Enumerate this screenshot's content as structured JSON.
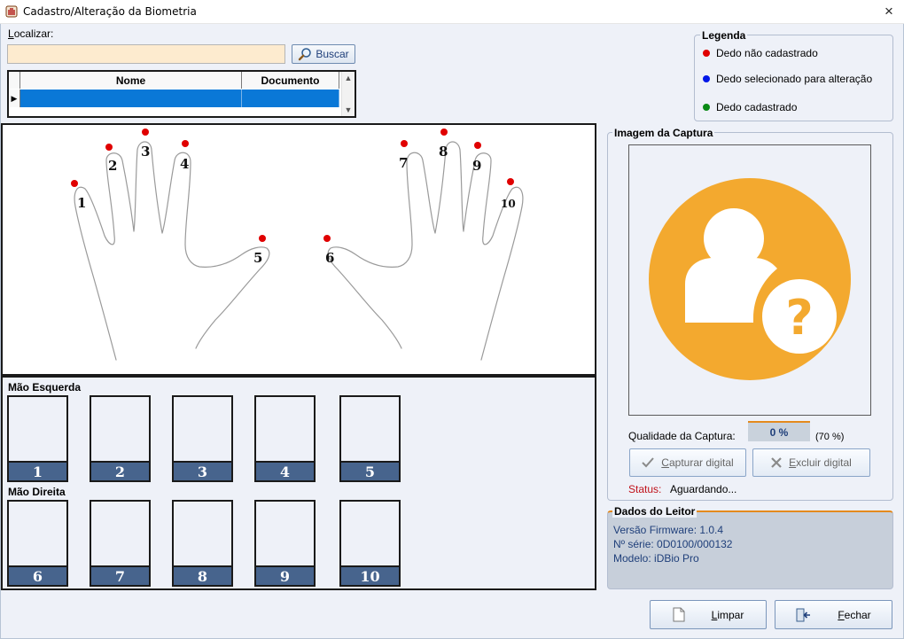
{
  "window": {
    "title": "Cadastro/Alteração da Biometria",
    "icon": "biometric-app-icon",
    "close_icon": "×"
  },
  "search": {
    "label_underlined": "L",
    "label_rest": "ocalizar:",
    "value": "",
    "button_label": "Buscar",
    "button_icon": "magnifier-icon"
  },
  "grid": {
    "columns": [
      "Nome",
      "Documento"
    ],
    "rows": [
      {
        "selected": true,
        "nome": "",
        "documento": ""
      }
    ]
  },
  "legend": {
    "title": "Legenda",
    "items": [
      {
        "label": "Dedo não cadastrado",
        "color": "#e00000"
      },
      {
        "label": "Dedo selecionado para alteração",
        "color": "#0017e8"
      },
      {
        "label": "Dedo cadastrado",
        "color": "#0a8a16"
      }
    ]
  },
  "fingers": {
    "labels": [
      "1",
      "2",
      "3",
      "4",
      "5",
      "6",
      "7",
      "8",
      "9",
      "10"
    ],
    "status_color": "#e00000"
  },
  "slots": {
    "left_hand_label": "Mão Esquerda",
    "right_hand_label": "Mão Direita",
    "left": [
      "1",
      "2",
      "3",
      "4",
      "5"
    ],
    "right": [
      "6",
      "7",
      "8",
      "9",
      "10"
    ]
  },
  "capture": {
    "title": "Imagem da Captura",
    "placeholder_icon": "unknown-user-icon",
    "placeholder_color": "#f3a92f",
    "quality_label": "Qualidade da Captura:",
    "quality_value": "0 %",
    "quality_threshold": "(70 %)",
    "capture_button": "Capturar digital",
    "capture_underlined": "C",
    "capture_rest": "apturar digital",
    "delete_button": "Excluir digital",
    "delete_underlined": "E",
    "delete_rest": "xcluir digital",
    "status_label": "Status:",
    "status_value": "Aguardando..."
  },
  "reader": {
    "title": "Dados do Leitor",
    "firmware": "Versão Firmware: 1.0.4",
    "serial": "Nº série: 0D0100/000132",
    "model": "Modelo: iDBio Pro"
  },
  "buttons": {
    "clear_underlined": "L",
    "clear_rest": "impar",
    "clear_icon": "blank-page-icon",
    "close_underlined": "F",
    "close_rest": "echar",
    "close_icon": "exit-door-icon"
  }
}
